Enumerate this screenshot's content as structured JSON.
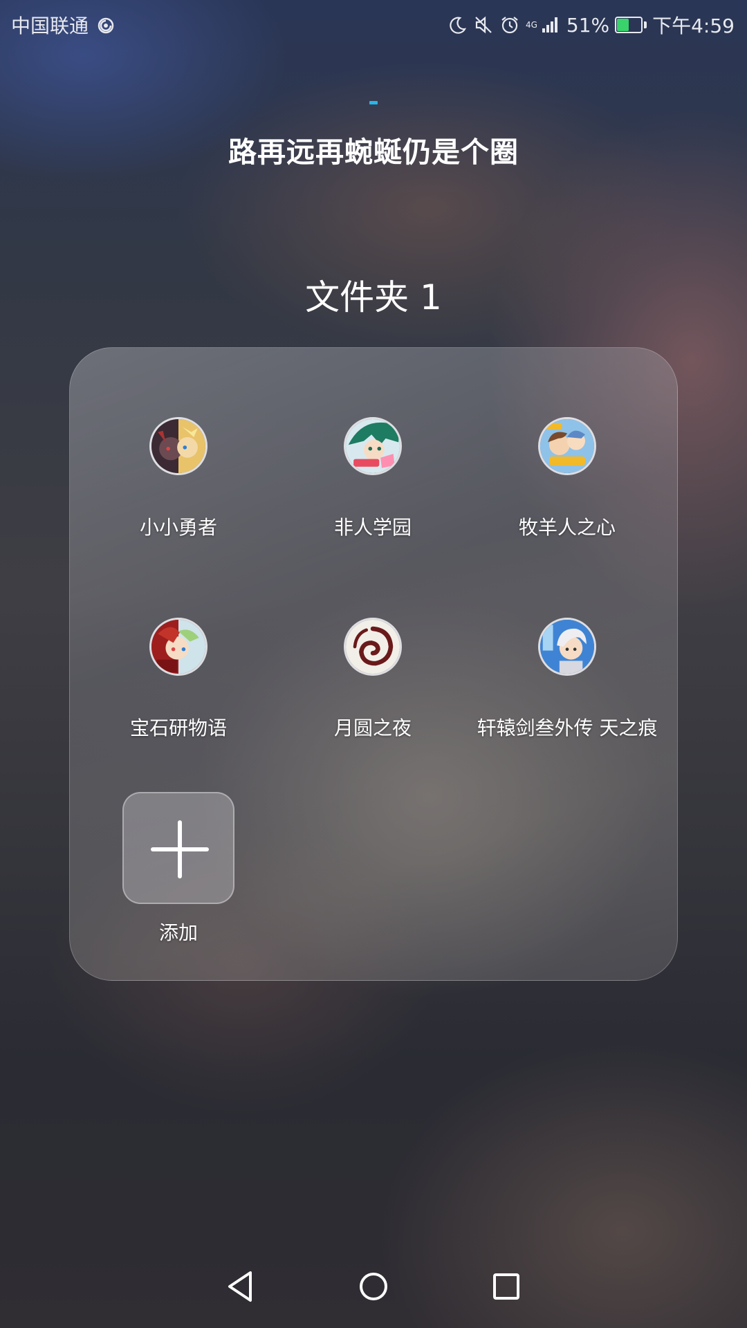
{
  "status_bar": {
    "carrier": "中国联通",
    "network_type": "4G",
    "battery_percent": "51%",
    "battery_level": 0.51,
    "time": "下午4:59",
    "icons": [
      "hotspot-icon",
      "moon-icon",
      "mute-icon",
      "alarm-icon",
      "signal-icon",
      "battery-icon"
    ]
  },
  "header": {
    "title": "路再远再蜿蜒仍是个圈"
  },
  "folder": {
    "name": "文件夹 1",
    "apps": [
      {
        "label": "小小勇者",
        "icon": "app-icon-xiaoxiao-yongzhe"
      },
      {
        "label": "非人学园",
        "icon": "app-icon-feiren-xueyuan"
      },
      {
        "label": "牧羊人之心",
        "icon": "app-icon-muyangren-zhixin"
      },
      {
        "label": "宝石研物语",
        "icon": "app-icon-baoshi-yanwuyu"
      },
      {
        "label": "月圆之夜",
        "icon": "app-icon-yueyuan-zhiye"
      },
      {
        "label": "轩辕剑叁外传 天之痕",
        "icon": "app-icon-xuanyuanjian"
      }
    ],
    "add_label": "添加"
  },
  "nav_bar": {
    "icons": [
      "back-icon",
      "home-icon",
      "recents-icon"
    ]
  },
  "colors": {
    "accent": "#28b6e8",
    "battery_fill": "#39d26b"
  }
}
